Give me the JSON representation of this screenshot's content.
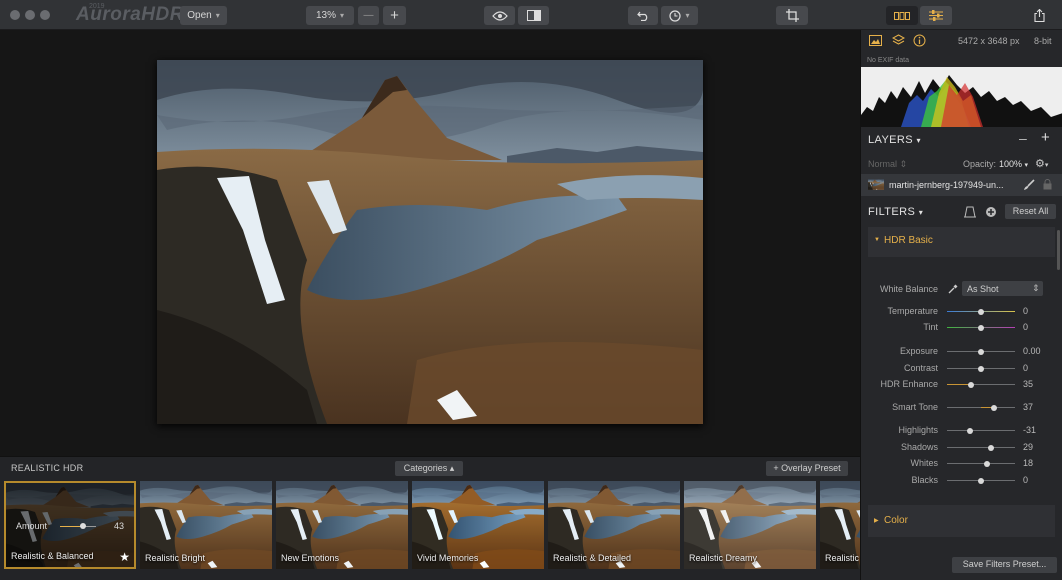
{
  "app": {
    "title": "AuroraHDR",
    "year": "2019"
  },
  "toolbar": {
    "open_label": "Open",
    "zoom": "13%"
  },
  "info": {
    "dimensions": "5472 x 3648 px",
    "bit_depth": "8-bit",
    "exif": "No EXIF data"
  },
  "layers": {
    "title": "LAYERS",
    "blend_mode": "Normal",
    "opacity_label": "Opacity:",
    "opacity_value": "100%",
    "layer_name": "martin-jernberg-197949-un..."
  },
  "filters": {
    "title": "FILTERS",
    "reset_label": "Reset All",
    "hdr_basic": "HDR Basic",
    "white_balance_label": "White Balance",
    "white_balance_value": "As Shot",
    "color_section": "Color",
    "save_label": "Save Filters Preset...",
    "sliders": [
      {
        "name": "temperature",
        "label": "Temperature",
        "value": "0",
        "frac": 0.5,
        "style": "temp"
      },
      {
        "name": "tint",
        "label": "Tint",
        "value": "0",
        "frac": 0.5,
        "style": "tint"
      },
      {
        "name": "exposure",
        "label": "Exposure",
        "value": "0.00",
        "frac": 0.5,
        "style": "plain"
      },
      {
        "name": "contrast",
        "label": "Contrast",
        "value": "0",
        "frac": 0.5,
        "style": "plain"
      },
      {
        "name": "hdr-enhance",
        "label": "HDR Enhance",
        "value": "35",
        "frac": 0.35,
        "style": "fill"
      },
      {
        "name": "smart-tone",
        "label": "Smart Tone",
        "value": "37",
        "frac": 0.685,
        "style": "center"
      },
      {
        "name": "highlights",
        "label": "Highlights",
        "value": "-31",
        "frac": 0.345,
        "style": "plain"
      },
      {
        "name": "shadows",
        "label": "Shadows",
        "value": "29",
        "frac": 0.645,
        "style": "plain"
      },
      {
        "name": "whites",
        "label": "Whites",
        "value": "18",
        "frac": 0.59,
        "style": "plain"
      },
      {
        "name": "blacks",
        "label": "Blacks",
        "value": "0",
        "frac": 0.5,
        "style": "plain"
      }
    ]
  },
  "presets": {
    "category_title": "REALISTIC HDR",
    "categories_label": "Categories",
    "overlay_label": "+ Overlay Preset",
    "amount_label": "Amount",
    "amount_value": "43",
    "amount_frac": 0.43,
    "items": [
      {
        "name": "Realistic & Balanced",
        "selected": true
      },
      {
        "name": "Realistic Bright"
      },
      {
        "name": "New Emotions"
      },
      {
        "name": "Vivid Memories"
      },
      {
        "name": "Realistic & Detailed"
      },
      {
        "name": "Realistic Dreamy"
      },
      {
        "name": "Realistic"
      }
    ]
  },
  "colors": {
    "accent": "#e5b04a",
    "selected_border": "#b58a2c"
  }
}
